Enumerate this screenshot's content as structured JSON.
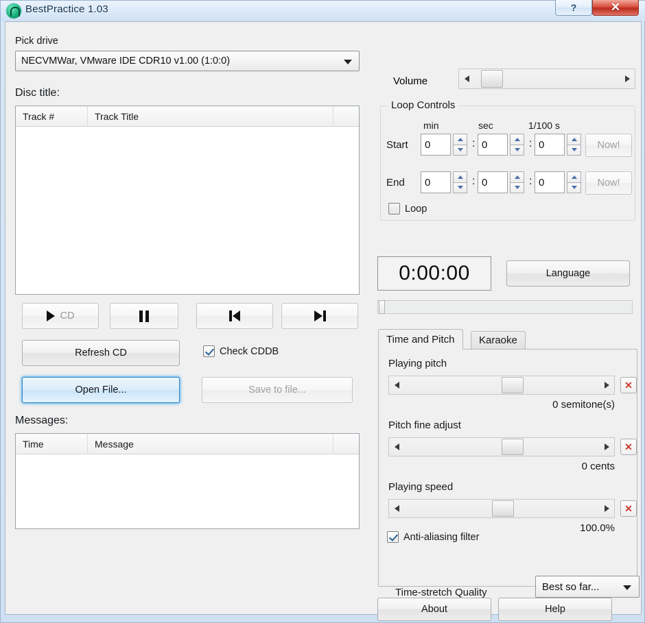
{
  "window": {
    "title": "BestPractice 1.03",
    "app_icon": "headphones-icon",
    "help_button": "?",
    "close_button": "✕"
  },
  "left": {
    "pick_drive_label": "Pick drive",
    "drive_combo": {
      "value": "NECVMWar, VMware IDE CDR10 v1.00 (1:0:0)",
      "options": [
        "NECVMWar, VMware IDE CDR10 v1.00 (1:0:0)"
      ]
    },
    "disc_title_label": "Disc title:",
    "track_list": {
      "columns": [
        "Track #",
        "Track Title"
      ],
      "rows": []
    },
    "transport": {
      "play_cd": "CD",
      "pause": "",
      "prev": "",
      "next": ""
    },
    "refresh_cd": "Refresh CD",
    "check_cddb": {
      "label": "Check CDDB",
      "checked": true
    },
    "open_file": "Open File...",
    "save_to_file": "Save to file...",
    "messages_label": "Messages:",
    "messages_list": {
      "columns": [
        "Time",
        "Message"
      ],
      "rows": []
    }
  },
  "right": {
    "volume_label": "Volume",
    "volume_value_pct": 10,
    "loop_group": {
      "title": "Loop Controls",
      "col_headers": [
        "min",
        "sec",
        "1/100 s"
      ],
      "start_label": "Start",
      "end_label": "End",
      "start_values": [
        "0",
        "0",
        "0"
      ],
      "end_values": [
        "0",
        "0",
        "0"
      ],
      "now_label": "Now!",
      "loop_checkbox": {
        "label": "Loop",
        "checked": false
      }
    },
    "timer": "0:00:00",
    "language_button": "Language",
    "seek_value_pct": 0,
    "tabs": [
      {
        "label": "Time and Pitch",
        "active": true
      },
      {
        "label": "Karaoke",
        "active": false
      }
    ],
    "time_and_pitch": {
      "playing_pitch": {
        "label": "Playing pitch",
        "value_text": "0 semitone(s)",
        "slider_pct": 50,
        "reset_icon": "✕"
      },
      "pitch_fine_adjust": {
        "label": "Pitch fine adjust",
        "value_text": "0 cents",
        "slider_pct": 50,
        "reset_icon": "✕"
      },
      "playing_speed": {
        "label": "Playing speed",
        "value_text": "100.0%",
        "slider_pct": 45,
        "reset_icon": "✕"
      },
      "anti_aliasing": {
        "label": "Anti-aliasing filter",
        "checked": true
      },
      "quality_label": "Time-stretch Quality",
      "quality_combo": {
        "value": "Best so far...",
        "options": [
          "Best so far..."
        ]
      }
    },
    "about_button": "About",
    "help_button": "Help"
  },
  "colors": {
    "accent_blue": "#2f83c8",
    "close_red": "#bb2b1c",
    "reset_red": "#d03a2e",
    "title_text": "#12314f",
    "face": "#f0f0f0"
  }
}
